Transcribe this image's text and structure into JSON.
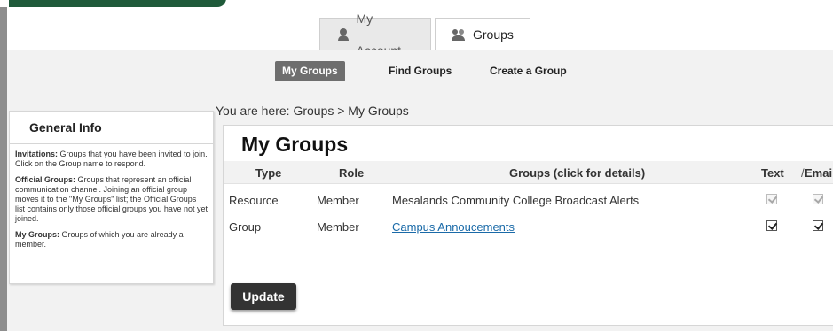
{
  "header": {
    "tabs": [
      {
        "label": "My Account",
        "icon": "person-icon",
        "active": false
      },
      {
        "label": "Groups",
        "icon": "group-icon",
        "active": true
      }
    ]
  },
  "subnav": {
    "items": [
      {
        "label": "My Groups",
        "active": true
      },
      {
        "label": "Find Groups",
        "active": false
      },
      {
        "label": "Create a Group",
        "active": false
      }
    ]
  },
  "breadcrumb": "You are here:  Groups > My Groups",
  "sidebar": {
    "title": "General Info",
    "paragraphs": [
      {
        "term": "Invitations:",
        "text": " Groups that you have been invited to join. Click on the Group name to respond."
      },
      {
        "term": "Official Groups:",
        "text": " Groups that represent an official communication channel. Joining an official group moves it to the \"My Groups\" list; the Official Groups list contains only those official groups you have not yet joined."
      },
      {
        "term": "My Groups:",
        "text": " Groups of which you are already a member."
      }
    ]
  },
  "main": {
    "title": "My Groups",
    "columns": {
      "type": "Type",
      "role": "Role",
      "groups": "Groups (click for details)",
      "text": "Text",
      "slash": "/",
      "email": "Email"
    },
    "rows": [
      {
        "type": "Resource",
        "role": "Member",
        "name": "Mesalands Community College Broadcast Alerts",
        "link": false,
        "text": true,
        "email": true,
        "disabled": true
      },
      {
        "type": "Group",
        "role": "Member",
        "name": "Campus Annoucements",
        "link": true,
        "text": true,
        "email": true,
        "disabled": false
      }
    ],
    "update_label": "Update"
  },
  "colors": {
    "brand_green": "#1f5a3a",
    "link": "#1a6aa8",
    "active_subnav": "#6e6e6e",
    "button": "#333333"
  }
}
